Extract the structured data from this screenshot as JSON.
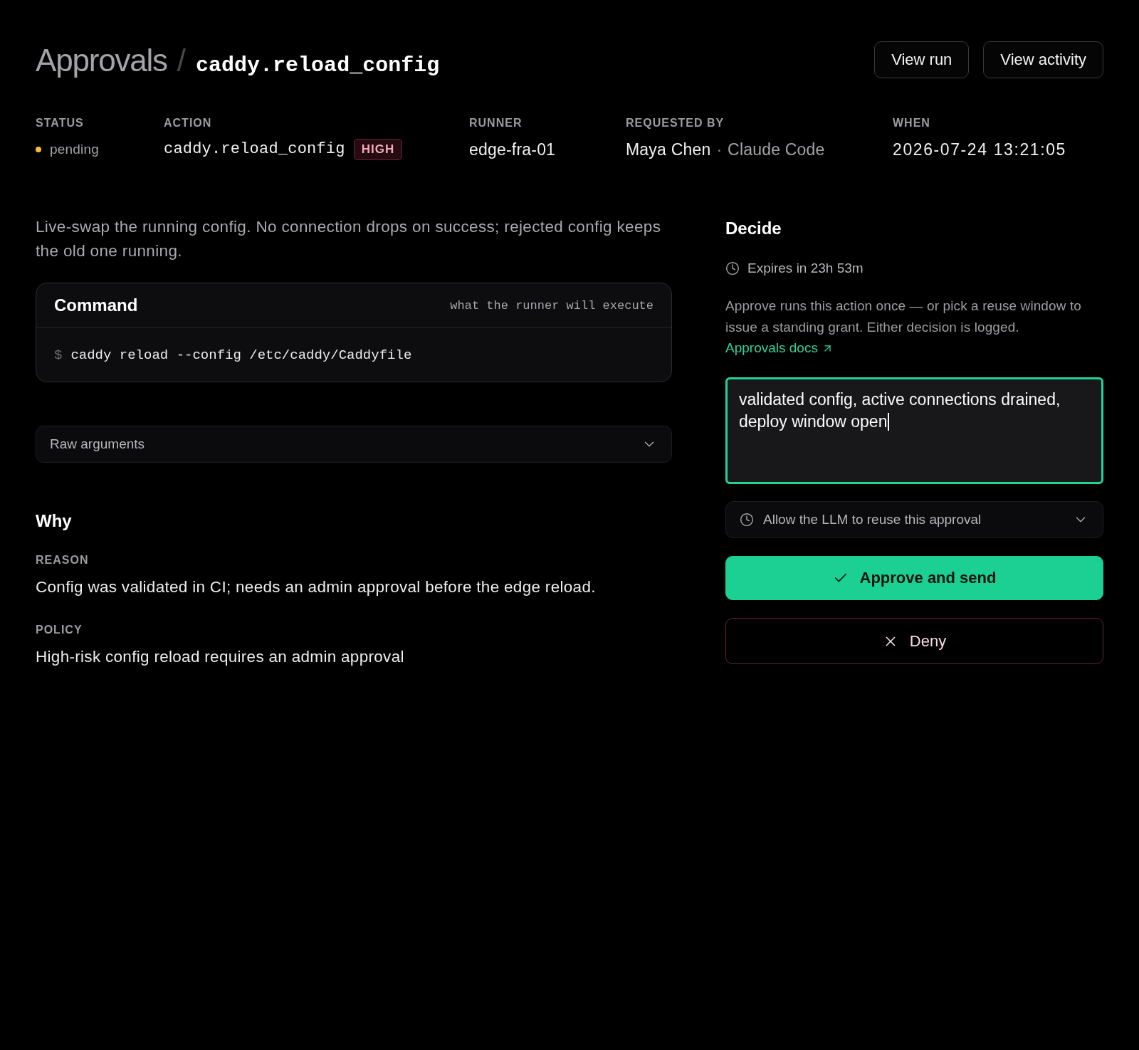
{
  "header": {
    "breadcrumb": "Approvals",
    "separator": "/",
    "title": "caddy.reload_config",
    "actions": [
      {
        "label": "View run"
      },
      {
        "label": "View activity"
      }
    ]
  },
  "meta": [
    {
      "kind": "status",
      "label": "STATUS",
      "value": "pending",
      "color": "#f5c033"
    },
    {
      "kind": "action",
      "label": "ACTION",
      "value": "caddy.reload_config",
      "badge": "HIGH"
    },
    {
      "kind": "text",
      "label": "RUNNER",
      "value": "edge-fra-01"
    },
    {
      "kind": "requester",
      "label": "REQUESTED BY",
      "value": "Maya Chen",
      "separator": "·",
      "secondary": "Claude Code"
    },
    {
      "kind": "time",
      "label": "WHEN",
      "value": "2026-07-24 13:21:05"
    }
  ],
  "description": "Live-swap the running config. No connection drops on success; rejected config keeps the old one running.",
  "command": {
    "title": "Command",
    "hint": "what the runner will execute",
    "prompt": "$",
    "text": "caddy reload --config /etc/caddy/Caddyfile"
  },
  "raw_arguments": {
    "label": "Raw arguments",
    "expanded": false
  },
  "why": {
    "title": "Why",
    "fields": [
      {
        "label": "REASON",
        "value": "Config was validated in CI; needs an admin approval before the edge reload."
      },
      {
        "label": "POLICY",
        "value": "High-risk config reload requires an admin approval"
      }
    ]
  },
  "decide": {
    "title": "Decide",
    "expires": "Expires in 23h 53m",
    "note": "Approve runs this action once — or pick a reuse window to issue a standing grant. Either decision is logged.",
    "link": "Approvals docs",
    "comment": {
      "value": "validated config, active connections drained, deploy window open",
      "focused": true
    },
    "reuse": {
      "label": "Allow the LLM to reuse this approval",
      "expanded": false
    },
    "buttons": [
      {
        "kind": "approve",
        "label": "Approve and send"
      },
      {
        "kind": "deny",
        "label": "Deny"
      }
    ]
  }
}
